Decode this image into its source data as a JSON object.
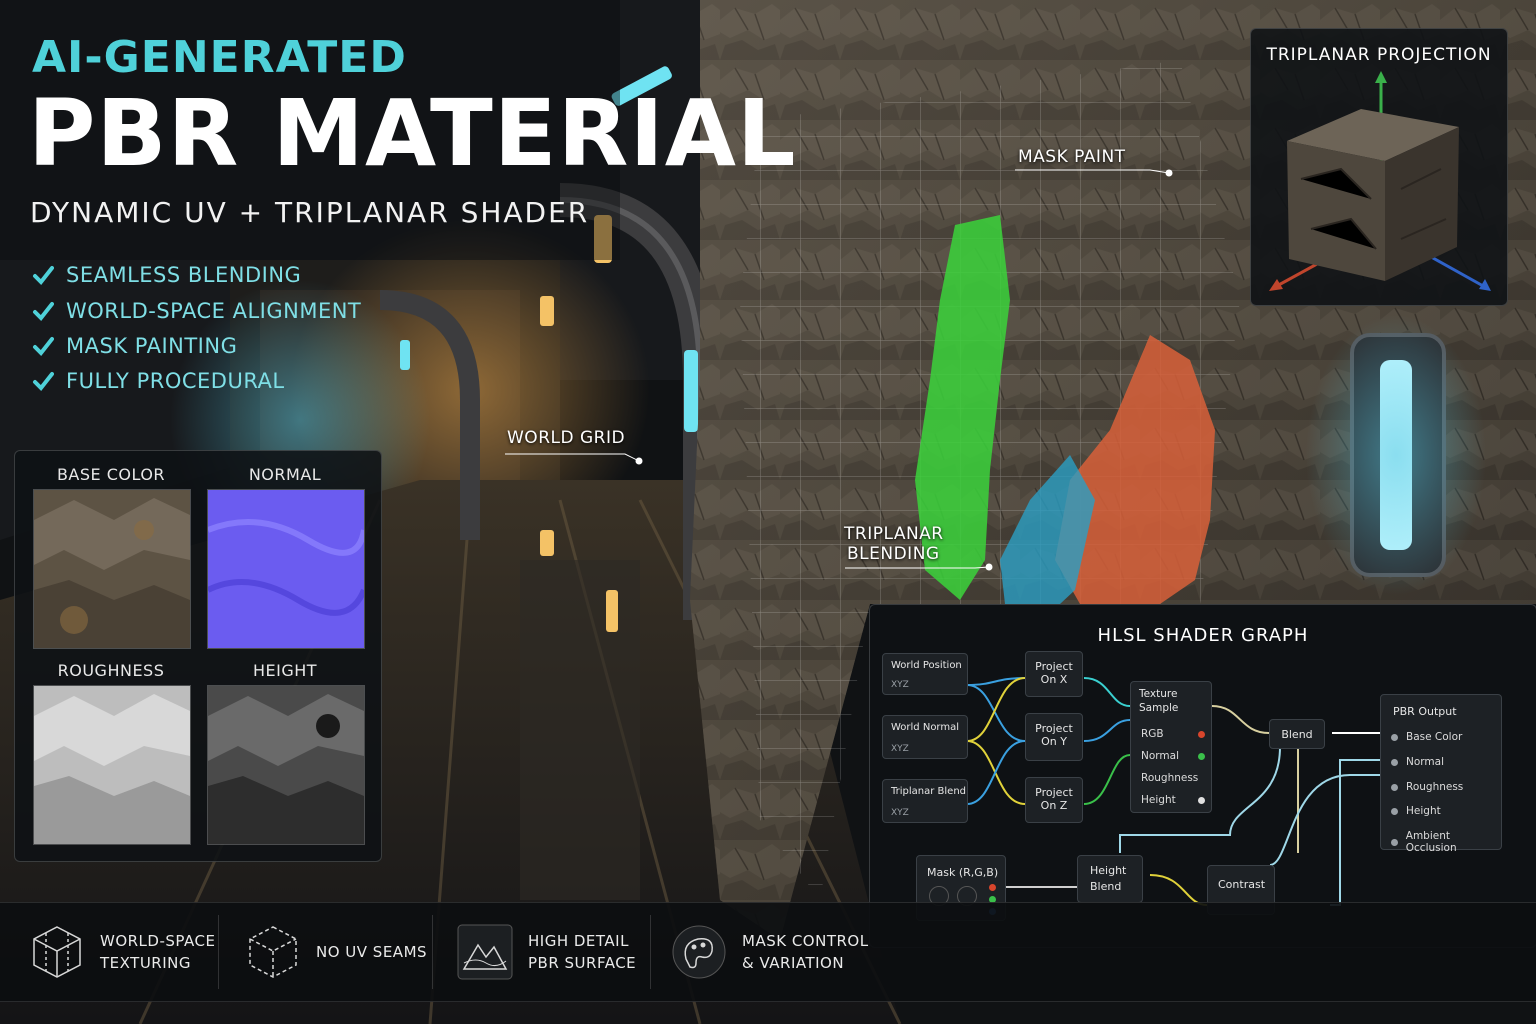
{
  "header": {
    "eyebrow": "AI-GENERATED",
    "title": "PBR MATERIAL",
    "subtitle": "DYNAMIC UV + TRIPLANAR SHADER"
  },
  "features": [
    "SEAMLESS BLENDING",
    "WORLD-SPACE ALIGNMENT",
    "MASK PAINTING",
    "FULLY PROCEDURAL"
  ],
  "maps": {
    "base_color": "BASE COLOR",
    "normal": "NORMAL",
    "roughness": "ROUGHNESS",
    "height": "HEIGHT"
  },
  "triplanar": {
    "title": "TRIPLANAR PROJECTION"
  },
  "callouts": {
    "world_grid": "WORLD GRID",
    "mask_paint": "MASK PAINT",
    "triplanar_blending_1": "TRIPLANAR",
    "triplanar_blending_2": "BLENDING"
  },
  "graph": {
    "title": "HLSL SHADER GRAPH",
    "inputs": [
      {
        "name": "World Position",
        "sub": "XYZ"
      },
      {
        "name": "World Normal",
        "sub": "XYZ"
      },
      {
        "name": "Triplanar Blend",
        "sub": "XYZ"
      }
    ],
    "projects": [
      {
        "l1": "Project",
        "l2": "On X"
      },
      {
        "l1": "Project",
        "l2": "On Y"
      },
      {
        "l1": "Project",
        "l2": "On Z"
      }
    ],
    "texture_sample": {
      "l1": "Texture",
      "l2": "Sample",
      "pins": [
        "RGB",
        "Normal",
        "Roughness",
        "Height"
      ]
    },
    "blend": "Blend",
    "mask": "Mask (R,G,B)",
    "height_blend_1": "Height",
    "height_blend_2": "Blend",
    "contrast": "Contrast",
    "output": {
      "title": "PBR Output",
      "pins": [
        "Base Color",
        "Normal",
        "Roughness",
        "Height",
        "Ambient Occlusion"
      ]
    }
  },
  "bottom": [
    {
      "l1": "WORLD-SPACE",
      "l2": "TEXTURING",
      "icon": "cube-wire-icon"
    },
    {
      "l1": "NO UV SEAMS",
      "l2": "",
      "icon": "cube-dashed-icon"
    },
    {
      "l1": "HIGH DETAIL",
      "l2": "PBR SURFACE",
      "icon": "mountain-icon"
    },
    {
      "l1": "MASK CONTROL",
      "l2": "& VARIATION",
      "icon": "palette-icon"
    }
  ],
  "colors": {
    "accent_cyan": "#4fd1d9",
    "mask_green": "#3bd43b",
    "mask_orange": "#d8603a",
    "mask_blue": "#2a9fc4",
    "axis_red": "#c0452c",
    "axis_green": "#3ab04a",
    "axis_blue": "#2f62c8",
    "normal_map": "#6b5cf0"
  }
}
